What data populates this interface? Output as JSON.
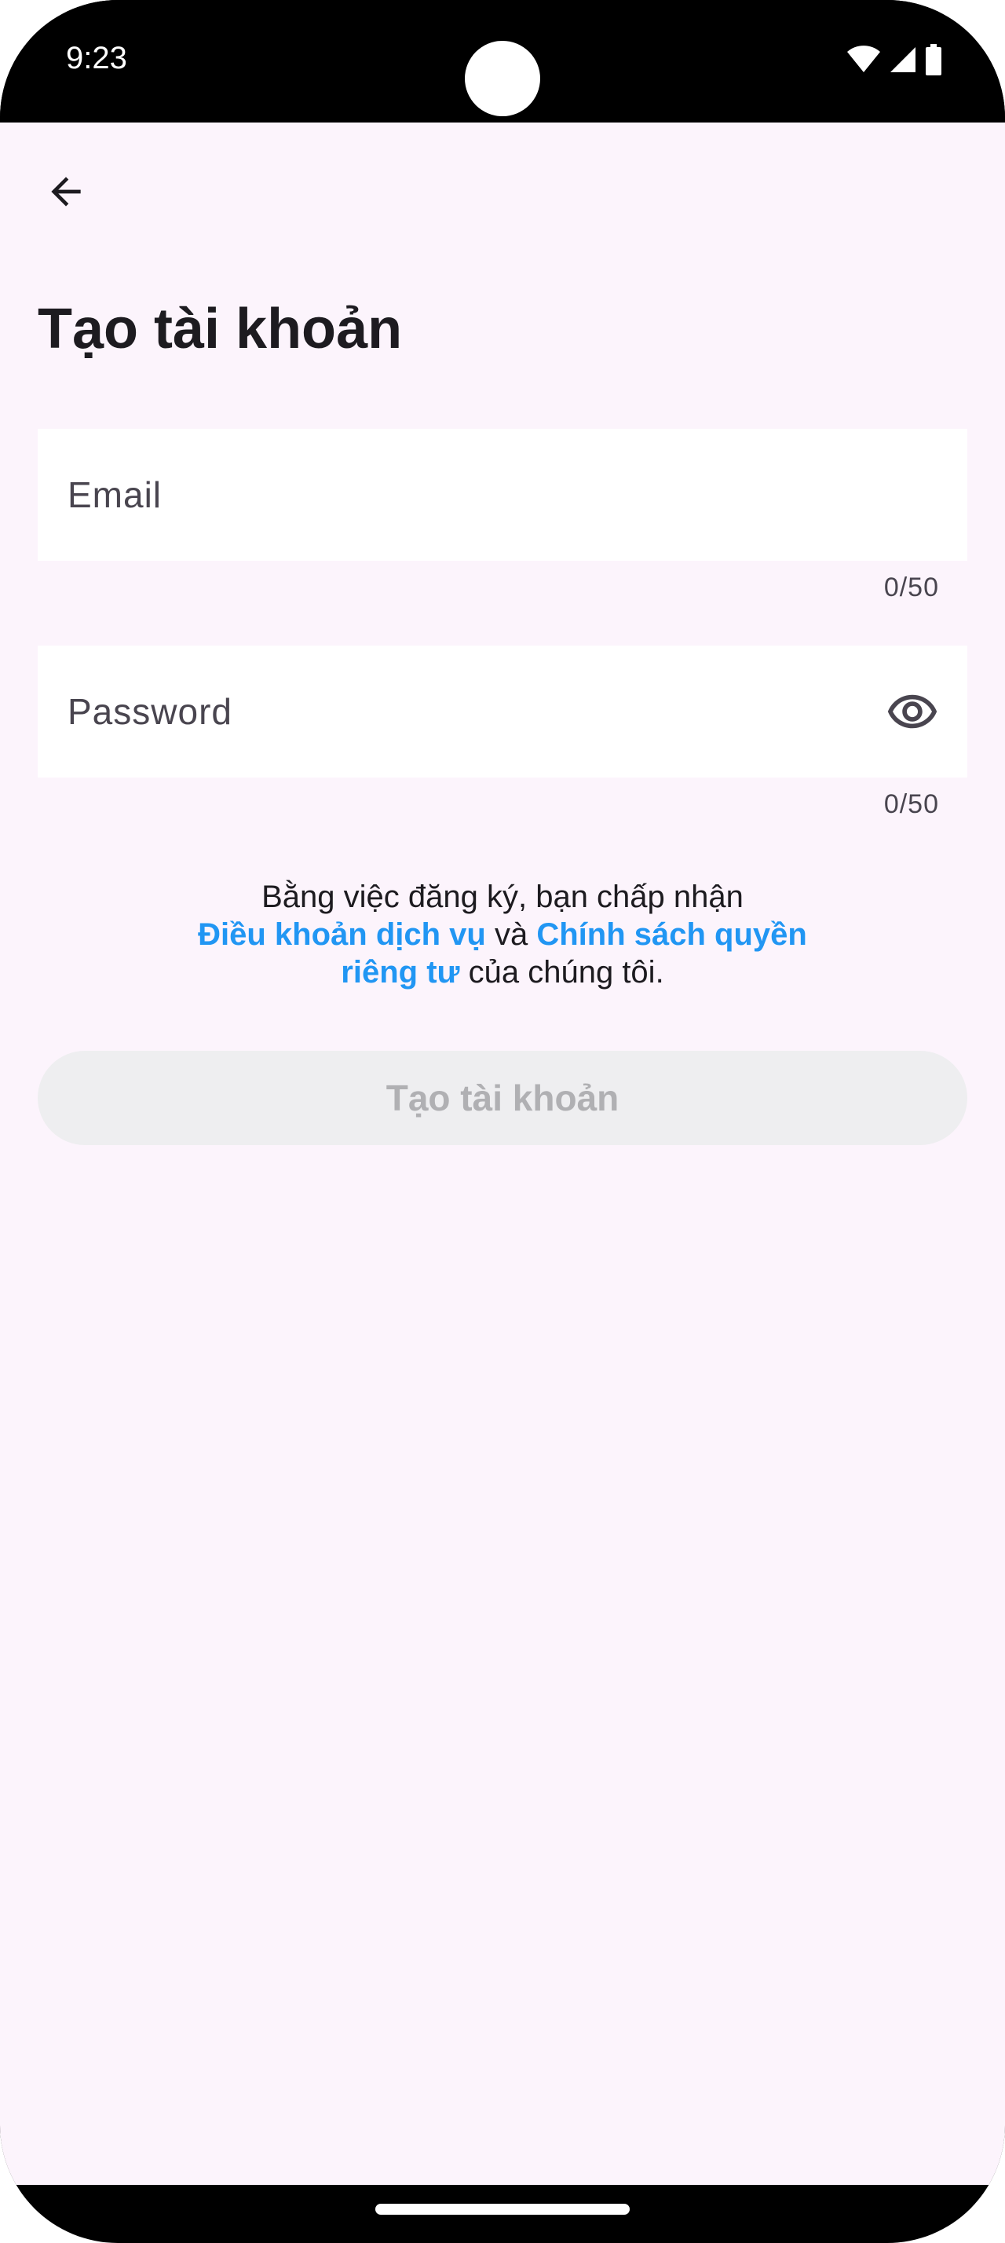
{
  "status_bar": {
    "time": "9:23",
    "icons": [
      "wifi-icon",
      "cellular-signal-icon",
      "battery-icon"
    ]
  },
  "header": {
    "back_icon": "arrow-back-icon"
  },
  "page": {
    "title": "Tạo tài khoản"
  },
  "form": {
    "email": {
      "placeholder": "Email",
      "value": "",
      "counter": "0/50"
    },
    "password": {
      "placeholder": "Password",
      "value": "",
      "counter": "0/50",
      "toggle_icon": "eye-icon"
    }
  },
  "terms": {
    "prefix": "Bằng việc đăng ký, bạn chấp nhận",
    "terms_link": "Điều khoản dịch vụ",
    "conjunction": " và ",
    "privacy_link": "Chính sách quyền riêng tư",
    "suffix": " của chúng tôi."
  },
  "submit": {
    "label": "Tạo tài khoản",
    "enabled": false
  },
  "colors": {
    "background": "#fcf4fc",
    "link": "#2196f3",
    "button_disabled_bg": "#eeeef0",
    "button_disabled_text": "#b0b0b3",
    "text": "#1d1b20"
  }
}
